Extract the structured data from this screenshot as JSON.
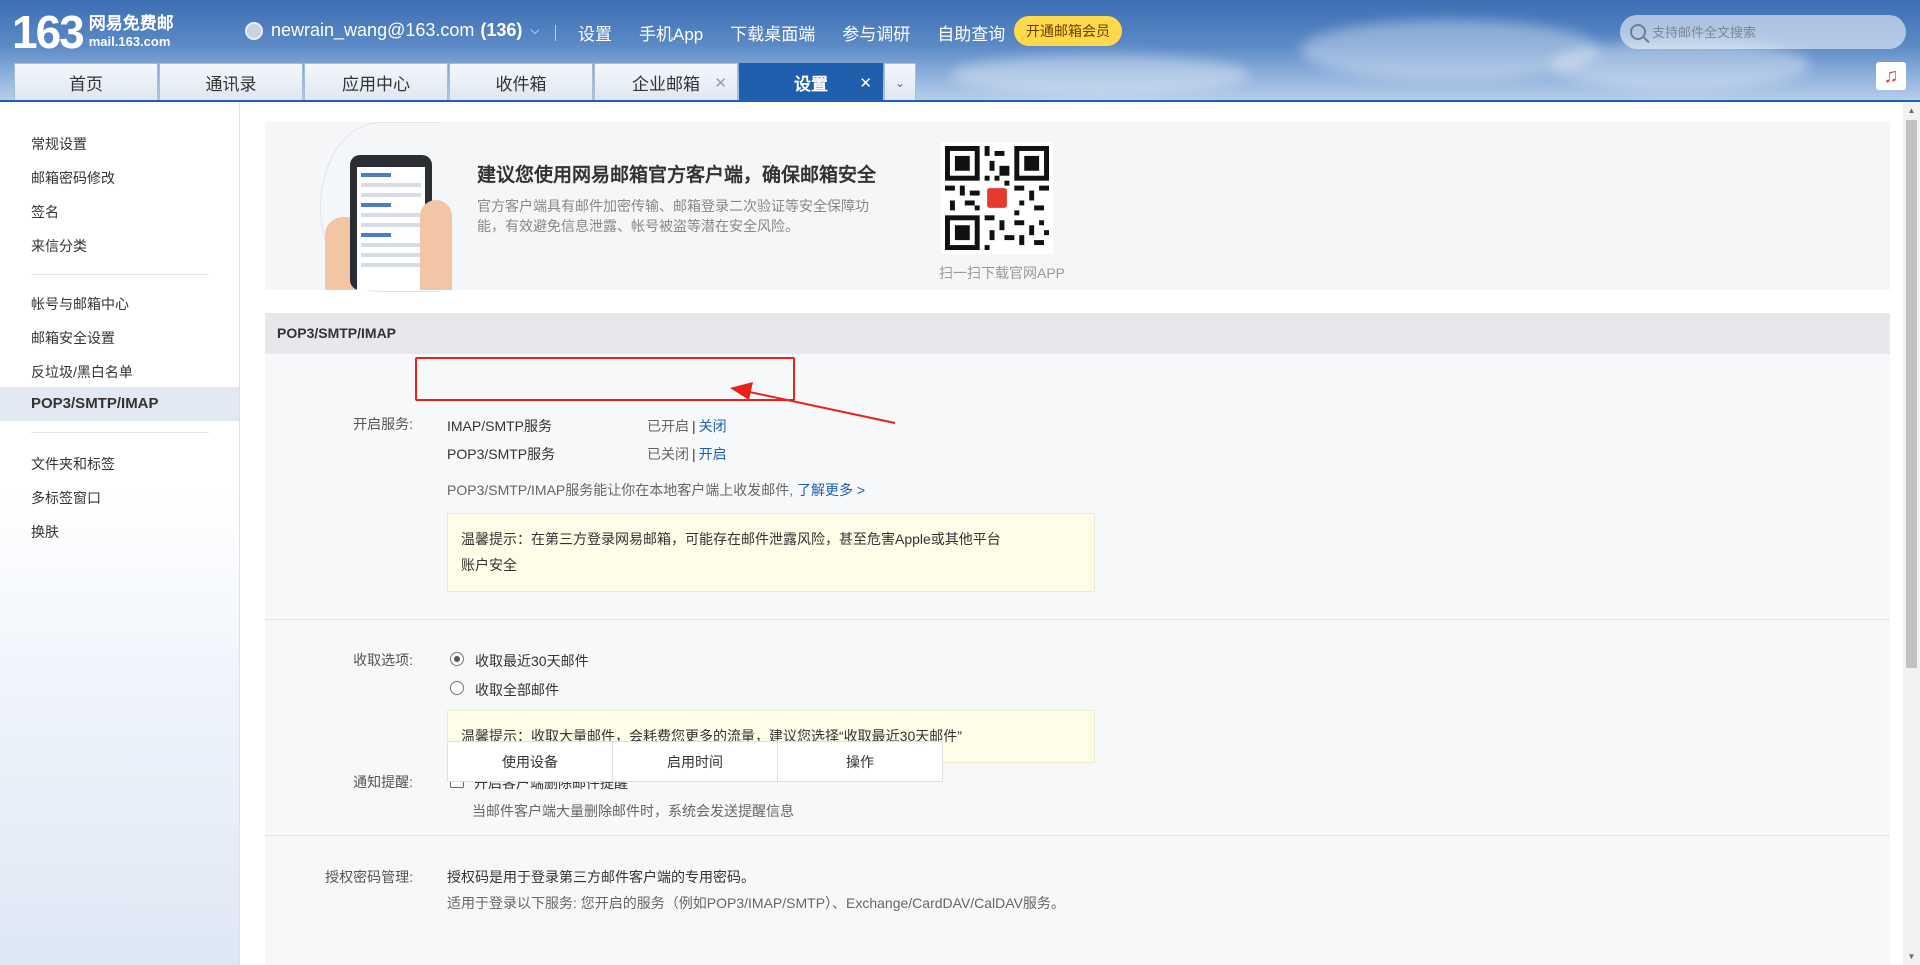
{
  "header": {
    "logo_num": "163",
    "logo_cn": "网易免费邮",
    "logo_en": "mail.163.com",
    "account": "newrain_wang@163.com",
    "unread": "(136)",
    "nav": [
      "设置",
      "手机App",
      "下载桌面端",
      "参与调研",
      "自助查询"
    ],
    "vip_label": "开通邮箱会员",
    "search_placeholder": "支持邮件全文搜索"
  },
  "tabs": [
    {
      "label": "首页",
      "closable": false,
      "active": false
    },
    {
      "label": "通讯录",
      "closable": false,
      "active": false
    },
    {
      "label": "应用中心",
      "closable": false,
      "active": false
    },
    {
      "label": "收件箱",
      "closable": false,
      "active": false
    },
    {
      "label": "企业邮箱",
      "closable": true,
      "active": false
    },
    {
      "label": "设置",
      "closable": true,
      "active": true
    }
  ],
  "sidebar": {
    "group1": [
      "常规设置",
      "邮箱密码修改",
      "签名",
      "来信分类"
    ],
    "group2": [
      "帐号与邮箱中心",
      "邮箱安全设置",
      "反垃圾/黑白名单",
      "POP3/SMTP/IMAP"
    ],
    "group3": [
      "文件夹和标签",
      "多标签窗口",
      "换肤"
    ],
    "active": "POP3/SMTP/IMAP"
  },
  "banner": {
    "title": "建议您使用网易邮箱官方客户端，确保邮箱安全",
    "desc": "官方客户端具有邮件加密传输、邮箱登录二次验证等安全保障功能，有效避免信息泄露、帐号被盗等潜在安全风险。",
    "qr_caption": "扫一扫下载官网APP"
  },
  "section": {
    "title": "POP3/SMTP/IMAP",
    "service_label": "开启服务:",
    "services": [
      {
        "name": "IMAP/SMTP服务",
        "status": "已开启",
        "action": "关闭"
      },
      {
        "name": "POP3/SMTP服务",
        "status": "已关闭",
        "action": "开启"
      }
    ],
    "service_desc": "POP3/SMTP/IMAP服务能让你在本地客户端上收发邮件,",
    "learn_more": "了解更多 >",
    "tip1": "温馨提示：在第三方登录网易邮箱，可能存在邮件泄露风险，甚至危害Apple或其他平台账户安全",
    "fetch_label": "收取选项:",
    "fetch_options": [
      "收取最近30天邮件",
      "收取全部邮件"
    ],
    "tip2": "温馨提示：收取大量邮件，会耗费您更多的流量，建议您选择“收取最近30天邮件”",
    "notify_label": "通知提醒:",
    "notify_option": "开启客户端删除邮件提醒",
    "notify_desc": "当邮件客户端大量删除邮件时，系统会发送提醒信息",
    "auth_label": "授权密码管理:",
    "auth_desc1": "授权码是用于登录第三方邮件客户端的专用密码。",
    "auth_desc2": "适用于登录以下服务: 您开启的服务（例如POP3/IMAP/SMTP）、Exchange/CardDAV/CalDAV服务。",
    "auth_table_headers": [
      "使用设备",
      "启用时间",
      "操作"
    ]
  },
  "colors": {
    "accent": "#1f5fad",
    "annotation": "#e8211c",
    "vip": "#ffd94a"
  }
}
